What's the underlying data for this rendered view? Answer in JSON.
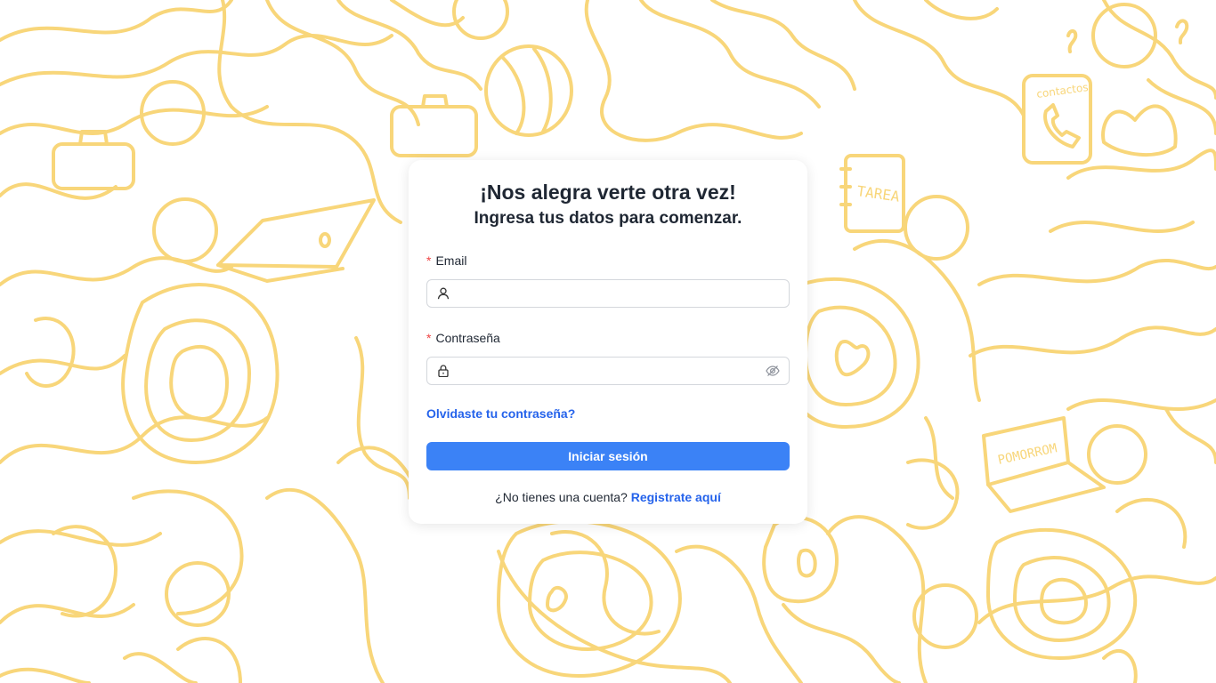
{
  "colors": {
    "doodle_stroke": "#f8d67a",
    "primary": "#3b82f6",
    "link": "#2563eb",
    "required_mark": "#ef4444",
    "text": "#1f2733"
  },
  "background": {
    "doodle_texts": {
      "notebook": "TAREA",
      "phonebook": "contactos",
      "laptop": "POMORROM"
    }
  },
  "login": {
    "title": "¡Nos alegra verte otra vez!",
    "subtitle": "Ingresa tus datos para comenzar.",
    "email": {
      "required_mark": "*",
      "label": "Email",
      "value": "",
      "icon": "user-icon"
    },
    "password": {
      "required_mark": "*",
      "label": "Contraseña",
      "value": "",
      "icon": "lock-icon",
      "toggle_icon": "eye-off-icon"
    },
    "forgot_link": "Olvidaste tu contraseña?",
    "submit_label": "Iniciar sesión",
    "register_prompt": "¿No tienes una cuenta?",
    "register_link": "Registrate aquí"
  }
}
